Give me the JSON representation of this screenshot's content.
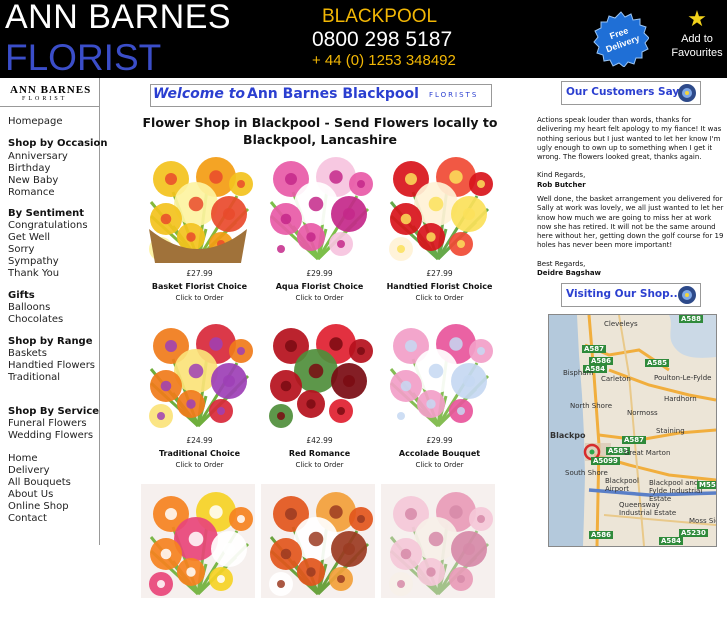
{
  "header": {
    "brand_line1": "ANN BARNES",
    "brand_line2": "FLORIST",
    "city": "BLACKPOOL",
    "phone": "0800 298 5187",
    "intl_phone": "+ 44 (0) 1253 348492",
    "badge_line1": "Free",
    "badge_line2": "Delivery",
    "favourites_line1": "Add to",
    "favourites_line2": "Favourites"
  },
  "sidebar": {
    "logo_line1": "ANN BARNES",
    "logo_line2": "FLORIST",
    "items": [
      {
        "label": "Homepage",
        "heading": false
      },
      {
        "label": "Shop by Occasion",
        "heading": true
      },
      {
        "label": "Anniversary",
        "heading": false
      },
      {
        "label": "Birthday",
        "heading": false
      },
      {
        "label": "New Baby",
        "heading": false
      },
      {
        "label": "Romance",
        "heading": false
      },
      {
        "label": "By Sentiment",
        "heading": true
      },
      {
        "label": "Congratulations",
        "heading": false
      },
      {
        "label": "Get Well",
        "heading": false
      },
      {
        "label": "Sorry",
        "heading": false
      },
      {
        "label": "Sympathy",
        "heading": false
      },
      {
        "label": "Thank You",
        "heading": false
      },
      {
        "label": "Gifts",
        "heading": true
      },
      {
        "label": "Balloons",
        "heading": false
      },
      {
        "label": "Chocolates",
        "heading": false
      },
      {
        "label": "Shop by Range",
        "heading": true
      },
      {
        "label": "Baskets",
        "heading": false
      },
      {
        "label": "Handtied Flowers",
        "heading": false
      },
      {
        "label": "Traditional",
        "heading": false
      },
      {
        "label": "Shop By Service",
        "heading": true
      },
      {
        "label": "Funeral Flowers",
        "heading": false
      },
      {
        "label": "Wedding Flowers",
        "heading": false
      },
      {
        "label": "Home",
        "heading": false
      },
      {
        "label": "Delivery",
        "heading": false
      },
      {
        "label": "All Bouquets",
        "heading": false
      },
      {
        "label": "About Us",
        "heading": false
      },
      {
        "label": "Online Shop",
        "heading": false
      },
      {
        "label": "Contact",
        "heading": false
      }
    ]
  },
  "welcome": {
    "part1": "Welcome to",
    "part2": "Ann Barnes Blackpool",
    "part3": "FLORISTS"
  },
  "main_title": "Flower Shop in Blackpool - Send Flowers locally to Blackpool, Lancashire",
  "products": [
    {
      "name": "Basket Florist Choice",
      "price": "£27.99",
      "click": "Click to Order",
      "icon": "basket-bouquet"
    },
    {
      "name": "Aqua Florist Choice",
      "price": "£29.99",
      "click": "Click to Order",
      "icon": "pink-lilies-bouquet"
    },
    {
      "name": "Handtied Florist Choice",
      "price": "£27.99",
      "click": "Click to Order",
      "icon": "red-gerbera-bouquet"
    },
    {
      "name": "Traditional Choice",
      "price": "£24.99",
      "click": "Click to Order",
      "icon": "orange-lilies-bouquet"
    },
    {
      "name": "Red Romance",
      "price": "£42.99",
      "click": "Click to Order",
      "icon": "red-roses-bouquet"
    },
    {
      "name": "Accolade Bouquet",
      "price": "£29.99",
      "click": "Click to Order",
      "icon": "pink-gerbera-bouquet"
    },
    {
      "icon": "mixed-gerbera-bouquet"
    },
    {
      "icon": "autumn-bouquet"
    },
    {
      "icon": "pastel-bouquet"
    }
  ],
  "right": {
    "customers_btn": "Our Customers Say..",
    "visit_btn": "Visiting Our Shop..",
    "testimonial1": "Actions speak louder than words, thanks for delivering my heart felt apology to my fiance! It was nothing serious but I just wanted to let her know I'm ugly enough to own up to something when I get it wrong. The flowers looked great, thanks again.",
    "testimonial1_signoff": "Kind Regards,",
    "testimonial1_author": "Rob Butcher",
    "testimonial2": "Well done, the basket arrangement you delivered for Sally at work was lovely, we all just wanted to let her know how much we are going to miss her at work now she has retired. It will not be the same around here without her, getting down the golf course for 19 holes has never been more important!",
    "testimonial2_signoff": "Best Regards,",
    "testimonial2_author": "Deidre Bagshaw"
  },
  "map": {
    "labels": [
      "Cleveleys",
      "A588",
      "A587",
      "A586",
      "A584",
      "Bispham",
      "Carleton",
      "A585",
      "Poulton-Le-Fylde",
      "Hardhorn",
      "North Shore",
      "Normoss",
      "Staining",
      "Blackpo",
      "A587",
      "A583",
      "A5099",
      "Great Marton",
      "South Shore",
      "Blackpool Airport",
      "Blackpool and Fylde Industrial Estate",
      "Queensway Industrial Estate",
      "Moss Side",
      "A5230",
      "A586",
      "M55",
      "A584"
    ],
    "colors": {
      "land": "#ece5d7",
      "sea": "#b4c9dc",
      "road": "#f1ae3d",
      "motorway": "#5a7fc7"
    }
  },
  "colors": {
    "header_bg": "#000000",
    "brand_blue": "#3b4ec9",
    "accent_gold": "#f2b705",
    "link_blue": "#2b3fd0"
  }
}
